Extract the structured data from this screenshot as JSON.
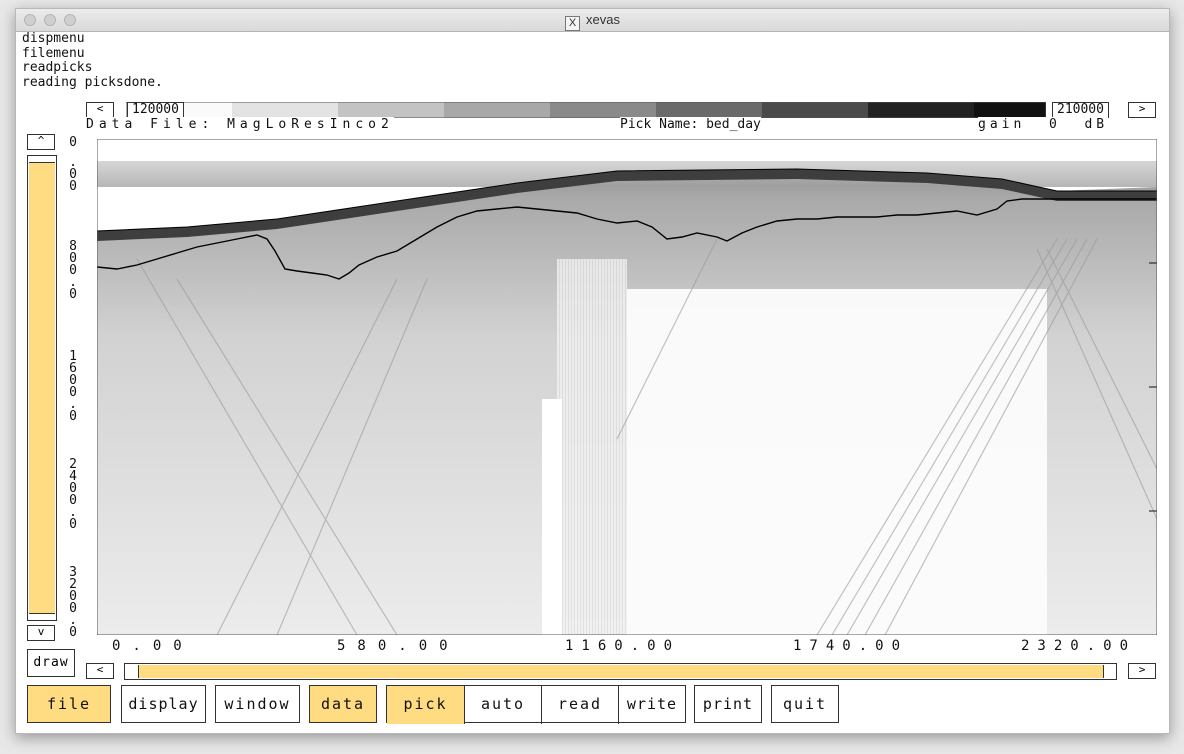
{
  "window": {
    "title": "xevas",
    "x_icon": "X"
  },
  "log_lines": [
    "dispmenu",
    "filemenu",
    "readpicks",
    "reading picksdone."
  ],
  "colorbar": {
    "left_arrow": "<",
    "right_arrow": ">",
    "min_value": "120000",
    "max_value": "210000"
  },
  "info": {
    "data_file": "Data File: MagLoResInco2",
    "pick_name": "Pick Name: bed_day",
    "gain": "gain  0  dB"
  },
  "vertical_scroll": {
    "up_arrow": "^",
    "down_arrow": "v",
    "position": 0.0
  },
  "y_axis_labels": [
    {
      "text": "0"
    },
    {
      "text": ".\n0\n0"
    },
    {
      "text": "8\n0\n0\n.\n0"
    },
    {
      "text": "1\n6\n0\n0\n.\n0"
    },
    {
      "text": "2\n4\n0\n0\n.\n0"
    },
    {
      "text": "3\n2\n0\n0\n.\n0"
    }
  ],
  "x_axis_labels": [
    "0.00",
    "580.00",
    "1160.00",
    "1740.00",
    "2320.00"
  ],
  "draw_button": "draw",
  "horizontal_scroll": {
    "left_arrow": "<",
    "right_arrow": ">"
  },
  "menu": {
    "file": "file",
    "display": "display",
    "window": "window",
    "data": "data",
    "pick": "pick",
    "auto": "auto",
    "read": "read",
    "write": "write",
    "print": "print",
    "quit": "quit"
  },
  "colors": {
    "accent": "#ffdc82",
    "pick_line": "#000000"
  }
}
